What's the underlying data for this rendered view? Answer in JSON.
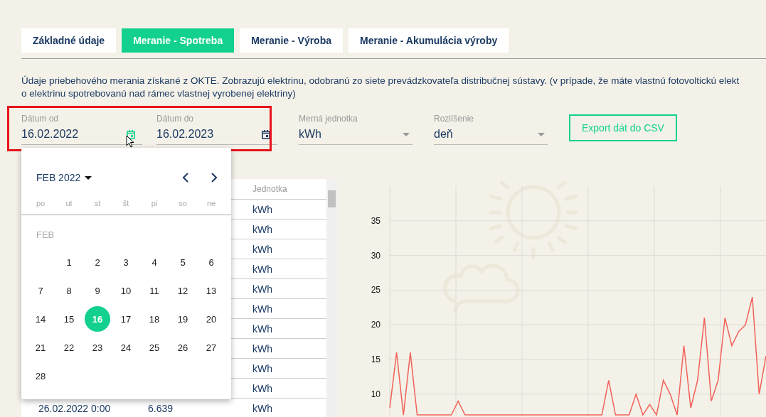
{
  "tabs": [
    {
      "label": "Základné údaje",
      "selected": false
    },
    {
      "label": "Meranie - Spotreba",
      "selected": true
    },
    {
      "label": "Meranie - Výroba",
      "selected": false
    },
    {
      "label": "Meranie - Akumulácia výroby",
      "selected": false
    }
  ],
  "description": "Údaje priebehového merania získané z OKTE. Zobrazujú elektrinu, odobranú zo siete prevádzkovateľa distribučnej sústavy. (v prípade, že máte vlastnú fotovoltickú elekt\no elektrinu spotrebovanú nad rámec vlastnej vyrobenej elektriny)",
  "filters": [
    {
      "kind": "date",
      "label": "Dátum od",
      "value": "16.02.2022",
      "highlighted": true
    },
    {
      "kind": "date",
      "label": "Dátum do",
      "value": "16.02.2023",
      "highlighted": false
    },
    {
      "kind": "select",
      "label": "Merná jednotka",
      "value": "kWh"
    },
    {
      "kind": "select",
      "label": "Rozlíšenie",
      "value": "deň"
    }
  ],
  "export_button": "Export dát do CSV",
  "table": {
    "columns": [
      "Jednotka"
    ],
    "rows": [
      {
        "unit": "kWh"
      },
      {
        "unit": "kWh"
      },
      {
        "unit": "kWh"
      },
      {
        "unit": "kWh"
      },
      {
        "unit": "kWh"
      },
      {
        "unit": "kWh"
      },
      {
        "unit": "kWh"
      },
      {
        "unit": "kWh"
      },
      {
        "unit": "kWh"
      },
      {
        "unit": "kWh"
      },
      {
        "date": "26.02.2022 0:00",
        "value": "6.639",
        "unit": "kWh"
      }
    ]
  },
  "calendar": {
    "month_label": "FEB 2022",
    "weekdays": [
      "po",
      "ut",
      "st",
      "št",
      "pi",
      "so",
      "ne"
    ],
    "section_label": "FEB",
    "days": [
      {
        "label": "1",
        "selected": false
      },
      {
        "label": "2",
        "selected": false
      },
      {
        "label": "3",
        "selected": false
      },
      {
        "label": "4",
        "selected": false
      },
      {
        "label": "5",
        "selected": false
      },
      {
        "label": "6",
        "selected": false
      },
      {
        "label": "7",
        "selected": false
      },
      {
        "label": "8",
        "selected": false
      },
      {
        "label": "9",
        "selected": false
      },
      {
        "label": "10",
        "selected": false
      },
      {
        "label": "11",
        "selected": false
      },
      {
        "label": "12",
        "selected": false
      },
      {
        "label": "13",
        "selected": false
      },
      {
        "label": "14",
        "selected": false
      },
      {
        "label": "15",
        "selected": false
      },
      {
        "label": "16",
        "selected": true
      },
      {
        "label": "17",
        "selected": false
      },
      {
        "label": "18",
        "selected": false
      },
      {
        "label": "19",
        "selected": false
      },
      {
        "label": "20",
        "selected": false
      },
      {
        "label": "21",
        "selected": false
      },
      {
        "label": "22",
        "selected": false
      },
      {
        "label": "23",
        "selected": false
      },
      {
        "label": "24",
        "selected": false
      },
      {
        "label": "25",
        "selected": false
      },
      {
        "label": "26",
        "selected": false
      },
      {
        "label": "27",
        "selected": false
      },
      {
        "label": "28",
        "selected": false
      }
    ]
  },
  "chart": {
    "chart_data": {
      "type": "line",
      "ylim": [
        6.7,
        40
      ],
      "yticks": [
        10,
        15,
        20,
        25,
        30,
        35
      ],
      "grid": true,
      "series": [
        {
          "color": "#f0625a",
          "values": [
            8,
            16,
            7,
            16,
            7,
            7,
            7,
            7,
            7,
            7,
            9,
            7,
            7,
            7,
            7,
            7,
            7,
            7,
            7,
            7,
            7,
            7,
            7,
            7,
            7,
            7,
            7,
            7,
            7,
            7,
            7,
            7,
            12,
            7,
            7,
            7,
            10,
            7,
            8.5,
            7,
            12,
            10,
            7,
            17,
            8,
            12,
            21,
            9,
            12,
            21,
            17,
            19,
            20,
            24,
            10,
            15.5
          ]
        }
      ]
    }
  }
}
